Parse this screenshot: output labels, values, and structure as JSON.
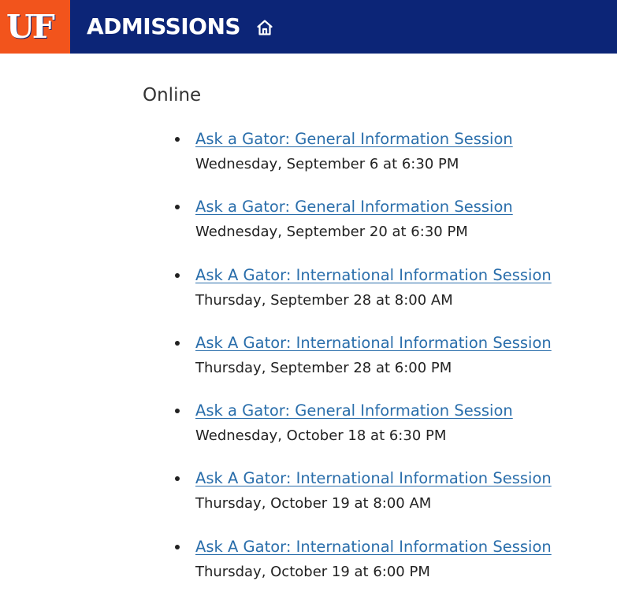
{
  "header": {
    "logo_text": "UF",
    "title": "ADMISSIONS",
    "home_icon": "home-icon",
    "colors": {
      "background": "#0c2577",
      "logo_background": "#f2541c"
    }
  },
  "main": {
    "heading": "Online",
    "sessions": [
      {
        "title": "Ask a Gator: General Information Session",
        "date": "Wednesday, September 6 at 6:30 PM"
      },
      {
        "title": "Ask a Gator: General Information Session",
        "date": "Wednesday, September 20 at 6:30 PM"
      },
      {
        "title": "Ask A Gator: International Information Session",
        "date": "Thursday, September 28 at 8:00 AM"
      },
      {
        "title": "Ask A Gator: International Information Session",
        "date": "Thursday, September 28 at 6:00 PM"
      },
      {
        "title": "Ask a Gator: General Information Session",
        "date": "Wednesday, October 18 at 6:30 PM"
      },
      {
        "title": "Ask A Gator: International Information Session",
        "date": "Thursday, October 19 at 8:00 AM"
      },
      {
        "title": "Ask A Gator: International Information Session",
        "date": "Thursday, October 19 at 6:00 PM"
      }
    ],
    "colors": {
      "link": "#2a6eab",
      "text": "#222222"
    }
  }
}
